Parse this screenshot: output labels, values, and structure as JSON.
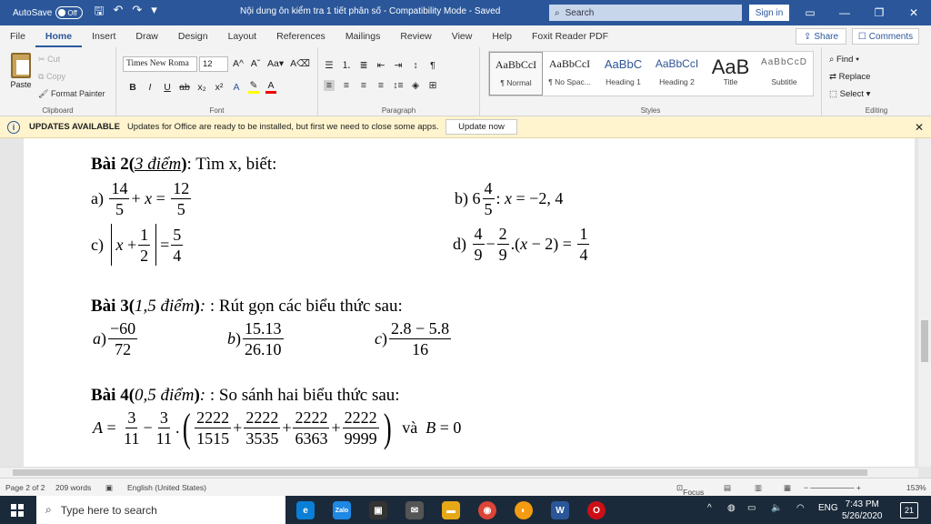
{
  "titlebar": {
    "autosave_label": "AutoSave",
    "autosave_state": "Off",
    "doc_title": "Nội dung ôn kiểm tra 1 tiết phân số  -  Compatibility Mode  -  Saved",
    "search_placeholder": "Search",
    "signin": "Sign in"
  },
  "menu": {
    "tabs": [
      "File",
      "Home",
      "Insert",
      "Draw",
      "Design",
      "Layout",
      "References",
      "Mailings",
      "Review",
      "View",
      "Help",
      "Foxit Reader PDF"
    ],
    "share": "Share",
    "comments": "Comments"
  },
  "ribbon": {
    "clipboard": {
      "paste": "Paste",
      "cut": "Cut",
      "copy": "Copy",
      "format_painter": "Format Painter",
      "label": "Clipboard"
    },
    "font": {
      "name": "Times New Roma",
      "size": "12",
      "label": "Font"
    },
    "paragraph": {
      "label": "Paragraph"
    },
    "styles": {
      "label": "Styles",
      "items": [
        {
          "preview": "AaBbCcI",
          "name": "¶ Normal"
        },
        {
          "preview": "AaBbCcI",
          "name": "¶ No Spac..."
        },
        {
          "preview": "AaBbC",
          "name": "Heading 1"
        },
        {
          "preview": "AaBbCcI",
          "name": "Heading 2"
        },
        {
          "preview": "AaB",
          "name": "Title"
        },
        {
          "preview": "AaBbCcD",
          "name": "Subtitle"
        }
      ]
    },
    "editing": {
      "find": "Find",
      "replace": "Replace",
      "select": "Select",
      "label": "Editing"
    }
  },
  "messagebar": {
    "title": "UPDATES AVAILABLE",
    "text": "Updates for Office are ready to be installed, but first we need to close some apps.",
    "button": "Update now"
  },
  "document": {
    "bai2": {
      "label": "Bài 2",
      "points": "3  điểm",
      "text": ": Tìm x, biết:"
    },
    "bai3": {
      "label": "Bài 3",
      "points": "1,5 điểm",
      "text": ": Rút gọn các biểu thức sau:"
    },
    "bai4": {
      "label": "Bài 4",
      "points": "0,5 điểm",
      "text": ": So sánh hai biểu thức sau:"
    }
  },
  "statusbar": {
    "page": "Page 2 of 2",
    "words": "209 words",
    "language": "English (United States)",
    "focus": "Focus",
    "zoom": "153%"
  },
  "taskbar": {
    "search_placeholder": "Type here to search",
    "lang": "ENG",
    "time": "7:43 PM",
    "date": "5/26/2020",
    "notifications": "21"
  }
}
